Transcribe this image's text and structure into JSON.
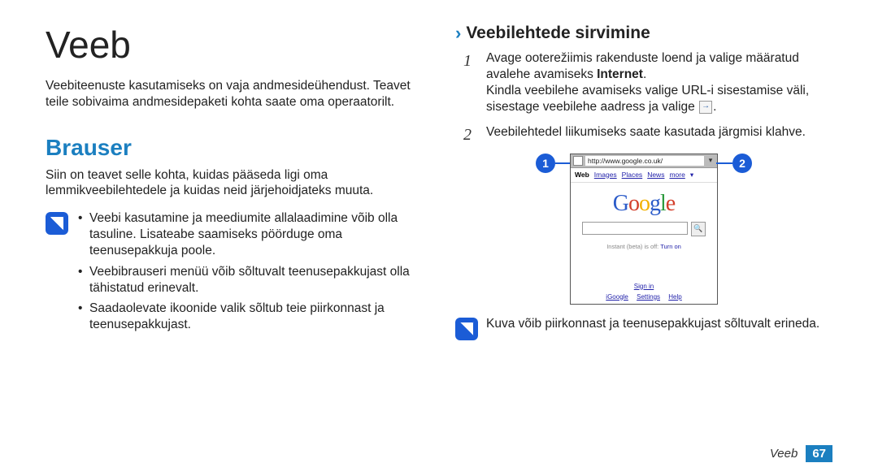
{
  "title": "Veeb",
  "intro": "Veebiteenuste kasutamiseks on vaja andmesideühendust. Teavet teile sobivaima andmesidepaketi kohta saate oma operaatorilt.",
  "section_heading": "Brauser",
  "section_intro": "Siin on teavet selle kohta, kuidas pääseda ligi oma lemmikveebilehtedele ja kuidas neid järjehoidjateks muuta.",
  "note_bullets": [
    "Veebi kasutamine ja meediumite allalaadimine võib olla tasuline. Lisateabe saamiseks pöörduge oma teenusepakkuja poole.",
    "Veebibrauseri menüü võib sõltuvalt teenusepakkujast olla tähistatud erinevalt.",
    "Saadaolevate ikoonide valik sõltub teie piirkonnast ja teenusepakkujast."
  ],
  "subheading": "Veebilehtede sirvimine",
  "step1_a": "Avage ooterežiimis rakenduste loend ja valige määratud avalehe avamiseks ",
  "step1_bold": "Internet",
  "step1_b": ".",
  "step1_c": "Kindla veebilehe avamiseks valige URL-i sisestamise väli, sisestage veebilehe aadress ja valige ",
  "step2": "Veebilehtedel liikumiseks saate kasutada järgmisi klahve.",
  "callout_1": "1",
  "callout_2": "2",
  "browser": {
    "url": "http://www.google.co.uk/",
    "tabs": [
      "Web",
      "Images",
      "Places",
      "News",
      "more"
    ],
    "logo": [
      "G",
      "o",
      "o",
      "g",
      "l",
      "e"
    ],
    "instant": "Instant (beta) is off: ",
    "instant_link": "Turn on",
    "sign_in": "Sign in",
    "links": [
      "iGoogle",
      "Settings",
      "Help"
    ]
  },
  "note2": "Kuva võib piirkonnast ja teenusepakkujast sõltuvalt erineda.",
  "footer_label": "Veeb",
  "page_number": "67"
}
